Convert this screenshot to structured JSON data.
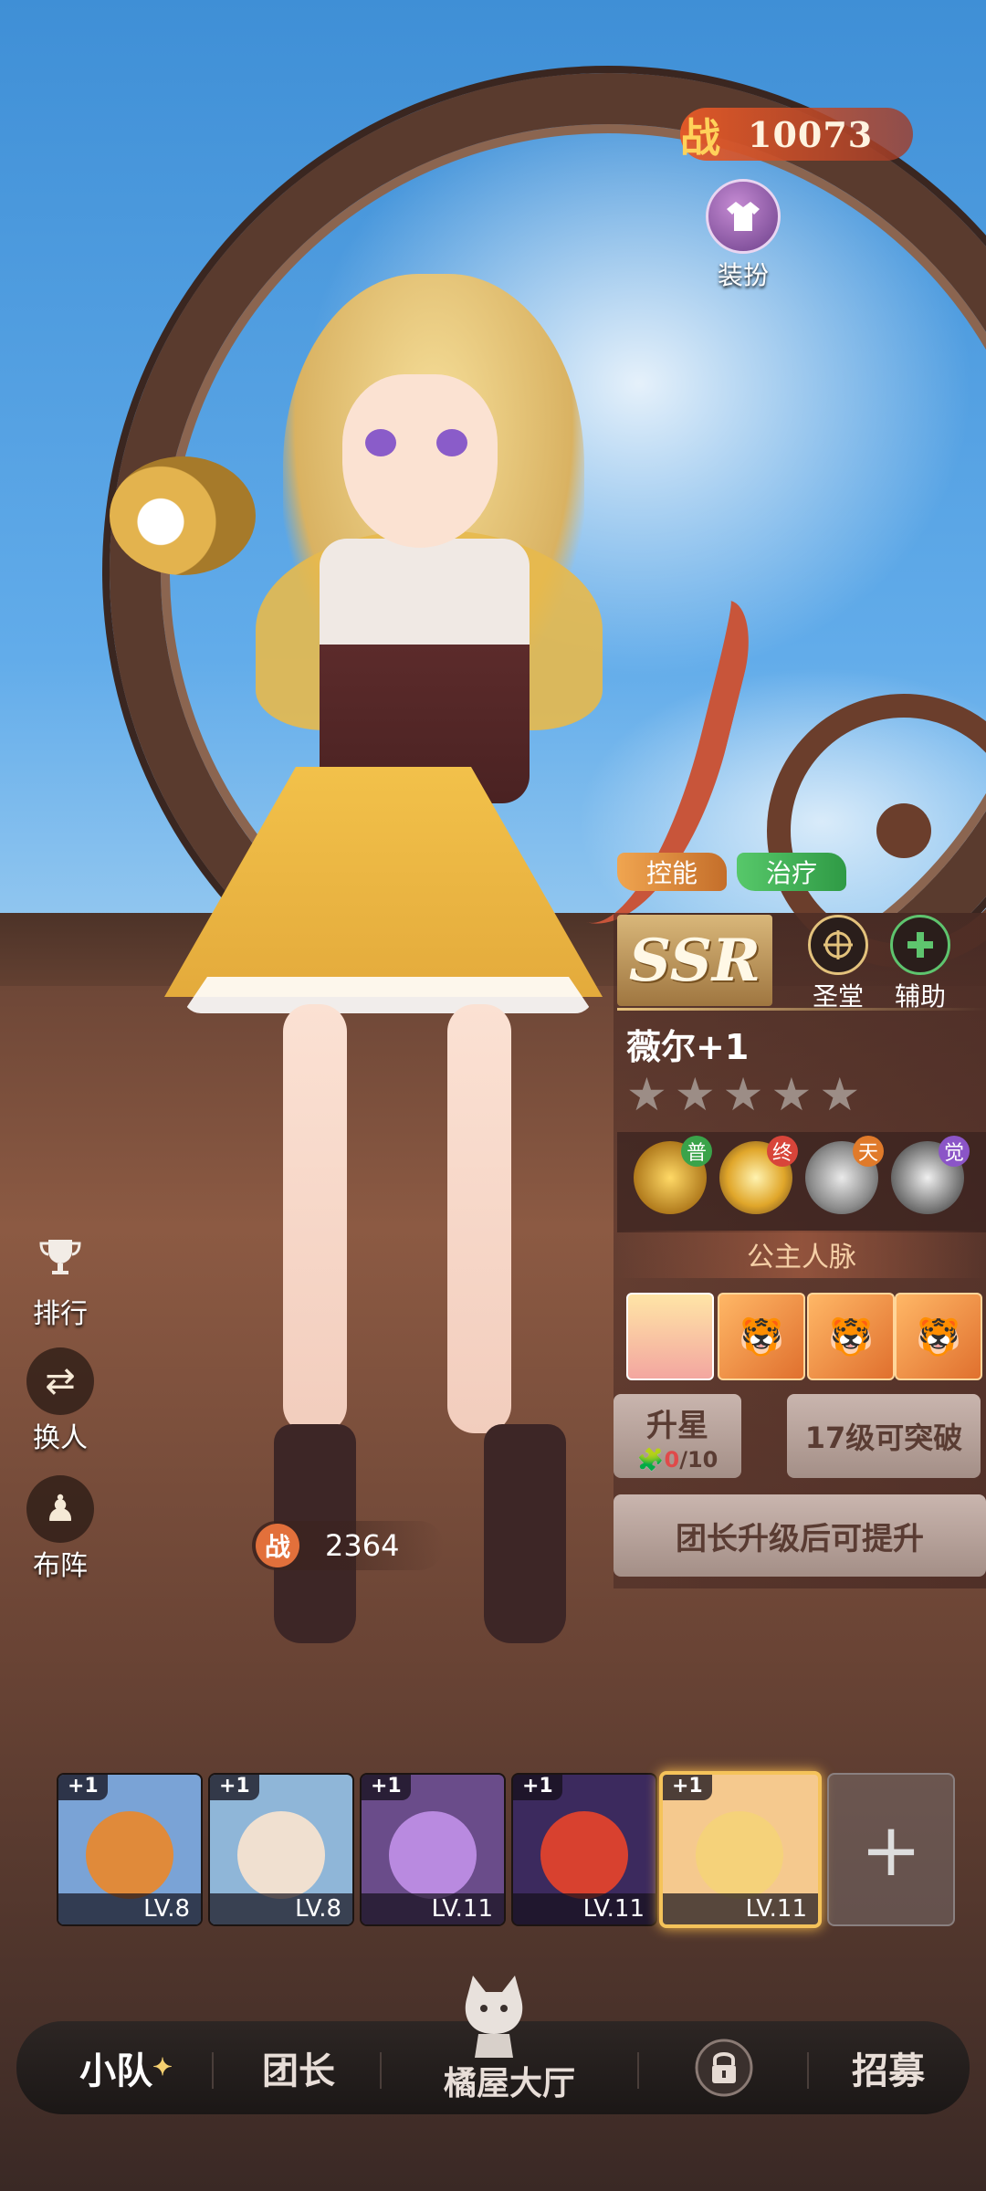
{
  "power_top": {
    "label": "战",
    "value": "10073"
  },
  "dress_button": {
    "label": "装扮"
  },
  "role_tags": [
    "控能",
    "治疗"
  ],
  "hero": {
    "rarity": "SSR",
    "faction": {
      "label": "圣堂",
      "icon": "crosshair-emblem-icon"
    },
    "role": {
      "label": "辅助",
      "icon": "plus-icon"
    },
    "name": "薇尔+1",
    "stars_total": 5,
    "stars_filled": 0,
    "skills": [
      {
        "mark": "普",
        "mark_color": "#3aa34a"
      },
      {
        "mark": "终",
        "mark_color": "#d8453a"
      },
      {
        "mark": "天",
        "mark_color": "#e07a2a"
      },
      {
        "mark": "觉",
        "mark_color": "#8b55c7"
      }
    ],
    "vein_title": "公主人脉",
    "star_up": {
      "label": "升星",
      "current": "0",
      "total": "/10"
    },
    "breakthrough": "17级可突破",
    "captain_hint": "团长升级后可提升"
  },
  "side_menu": [
    {
      "label": "排行",
      "icon": "trophy-icon"
    },
    {
      "label": "换人",
      "icon": "swap-icon"
    },
    {
      "label": "布阵",
      "icon": "formation-icon"
    }
  ],
  "power_bottom": {
    "label": "战",
    "value": "2364"
  },
  "team": [
    {
      "plus": "+1",
      "level": "LV.8",
      "color": "#e08a3a",
      "bg": "#7aa3d6"
    },
    {
      "plus": "+1",
      "level": "LV.8",
      "color": "#f0e0d0",
      "bg": "#8fb6d8"
    },
    {
      "plus": "+1",
      "level": "LV.11",
      "color": "#b98ae0",
      "bg": "#6a4c8a"
    },
    {
      "plus": "+1",
      "level": "LV.11",
      "color": "#d8412f",
      "bg": "#3c2a5e"
    },
    {
      "plus": "+1",
      "level": "LV.11",
      "color": "#f5d27a",
      "bg": "#f5c98e",
      "selected": true
    }
  ],
  "nav": {
    "squad": "小队",
    "captain": "团长",
    "hall": "橘屋大厅",
    "recruit": "招募"
  }
}
